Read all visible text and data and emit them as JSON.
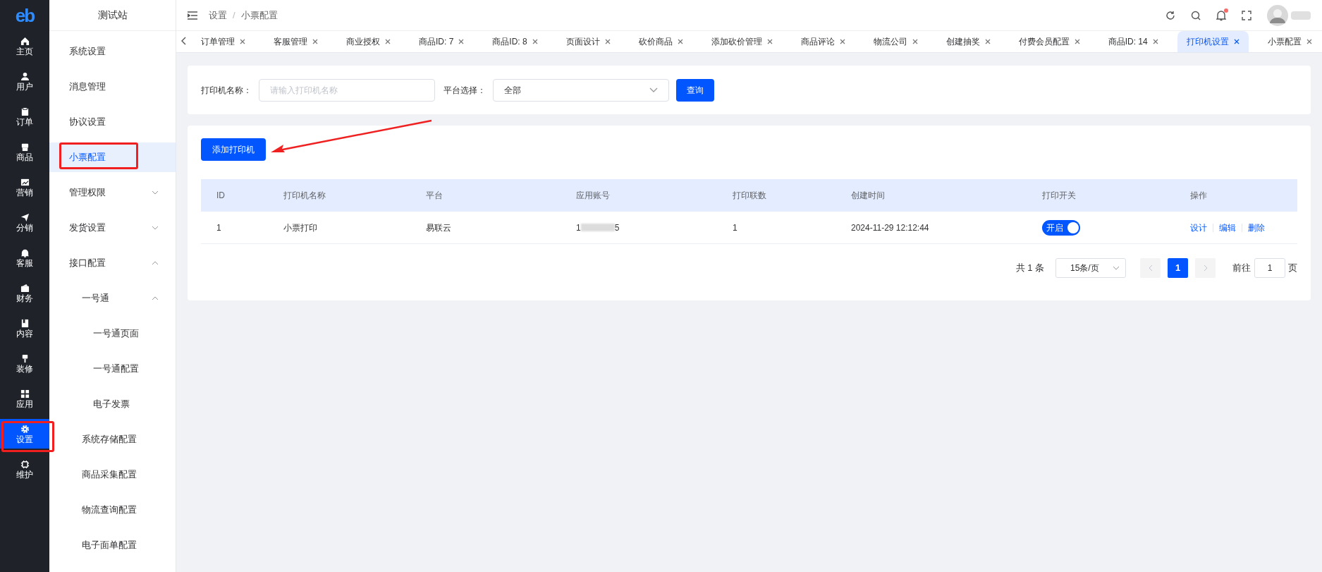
{
  "logo": "eb",
  "rail": [
    {
      "label": "主页",
      "selected": false
    },
    {
      "label": "用户",
      "selected": false
    },
    {
      "label": "订单",
      "selected": false
    },
    {
      "label": "商品",
      "selected": false
    },
    {
      "label": "营销",
      "selected": false
    },
    {
      "label": "分销",
      "selected": false
    },
    {
      "label": "客服",
      "selected": false
    },
    {
      "label": "财务",
      "selected": false
    },
    {
      "label": "内容",
      "selected": false
    },
    {
      "label": "装修",
      "selected": false
    },
    {
      "label": "应用",
      "selected": false
    },
    {
      "label": "设置",
      "selected": true
    },
    {
      "label": "维护",
      "selected": false
    }
  ],
  "sidebar": {
    "title": "测试站",
    "items": [
      {
        "label": "系统设置",
        "selected": false
      },
      {
        "label": "消息管理",
        "selected": false
      },
      {
        "label": "协议设置",
        "selected": false
      },
      {
        "label": "小票配置",
        "selected": true
      },
      {
        "label": "管理权限",
        "selected": false,
        "expanded": false
      },
      {
        "label": "发货设置",
        "selected": false,
        "expanded": false
      },
      {
        "label": "接口配置",
        "selected": false,
        "expanded": true,
        "children": [
          {
            "label": "一号通",
            "selected": false,
            "expanded": true,
            "children": [
              {
                "label": "一号通页面",
                "selected": false
              },
              {
                "label": "一号通配置",
                "selected": false
              },
              {
                "label": "电子发票",
                "selected": false
              }
            ]
          },
          {
            "label": "系统存储配置",
            "selected": false
          },
          {
            "label": "商品采集配置",
            "selected": false
          },
          {
            "label": "物流查询配置",
            "selected": false
          },
          {
            "label": "电子面单配置",
            "selected": false
          }
        ]
      }
    ]
  },
  "breadcrumb": [
    "设置",
    "小票配置"
  ],
  "breadcrumb_separator": "/",
  "notification_dot": true,
  "tabs": [
    {
      "label": "订单管理",
      "selected": false
    },
    {
      "label": "客服管理",
      "selected": false
    },
    {
      "label": "商业授权",
      "selected": false
    },
    {
      "label": "商品ID: 7",
      "selected": false
    },
    {
      "label": "商品ID: 8",
      "selected": false
    },
    {
      "label": "页面设计",
      "selected": false
    },
    {
      "label": "砍价商品",
      "selected": false
    },
    {
      "label": "添加砍价管理",
      "selected": false
    },
    {
      "label": "商品评论",
      "selected": false
    },
    {
      "label": "物流公司",
      "selected": false
    },
    {
      "label": "创建抽奖",
      "selected": false
    },
    {
      "label": "付费会员配置",
      "selected": false
    },
    {
      "label": "商品ID: 14",
      "selected": false
    },
    {
      "label": "打印机设置",
      "selected": true
    },
    {
      "label": "小票配置",
      "selected": false
    }
  ],
  "filter": {
    "name_label": "打印机名称：",
    "name_placeholder": "请输入打印机名称",
    "platform_label": "平台选择：",
    "platform_value": "全部",
    "query_button": "查询"
  },
  "add_button": "添加打印机",
  "table": {
    "columns": [
      "ID",
      "打印机名称",
      "平台",
      "应用账号",
      "打印联数",
      "创建时间",
      "打印开关",
      "操作"
    ],
    "rows": [
      {
        "id": "1",
        "name": "小票打印",
        "platform": "易联云",
        "account_start": "1",
        "account_end": "5",
        "copies": "1",
        "created": "2024-11-29 12:12:44",
        "switch": {
          "on": true,
          "label": "开启"
        },
        "actions": [
          "设计",
          "编辑",
          "删除"
        ]
      }
    ]
  },
  "pagination": {
    "total": "共 1 条",
    "page_size": "15条/页",
    "pages": [
      {
        "label": "1",
        "selected": true
      }
    ],
    "goto_label": "前往",
    "goto_value": "1",
    "goto_suffix": "页"
  }
}
